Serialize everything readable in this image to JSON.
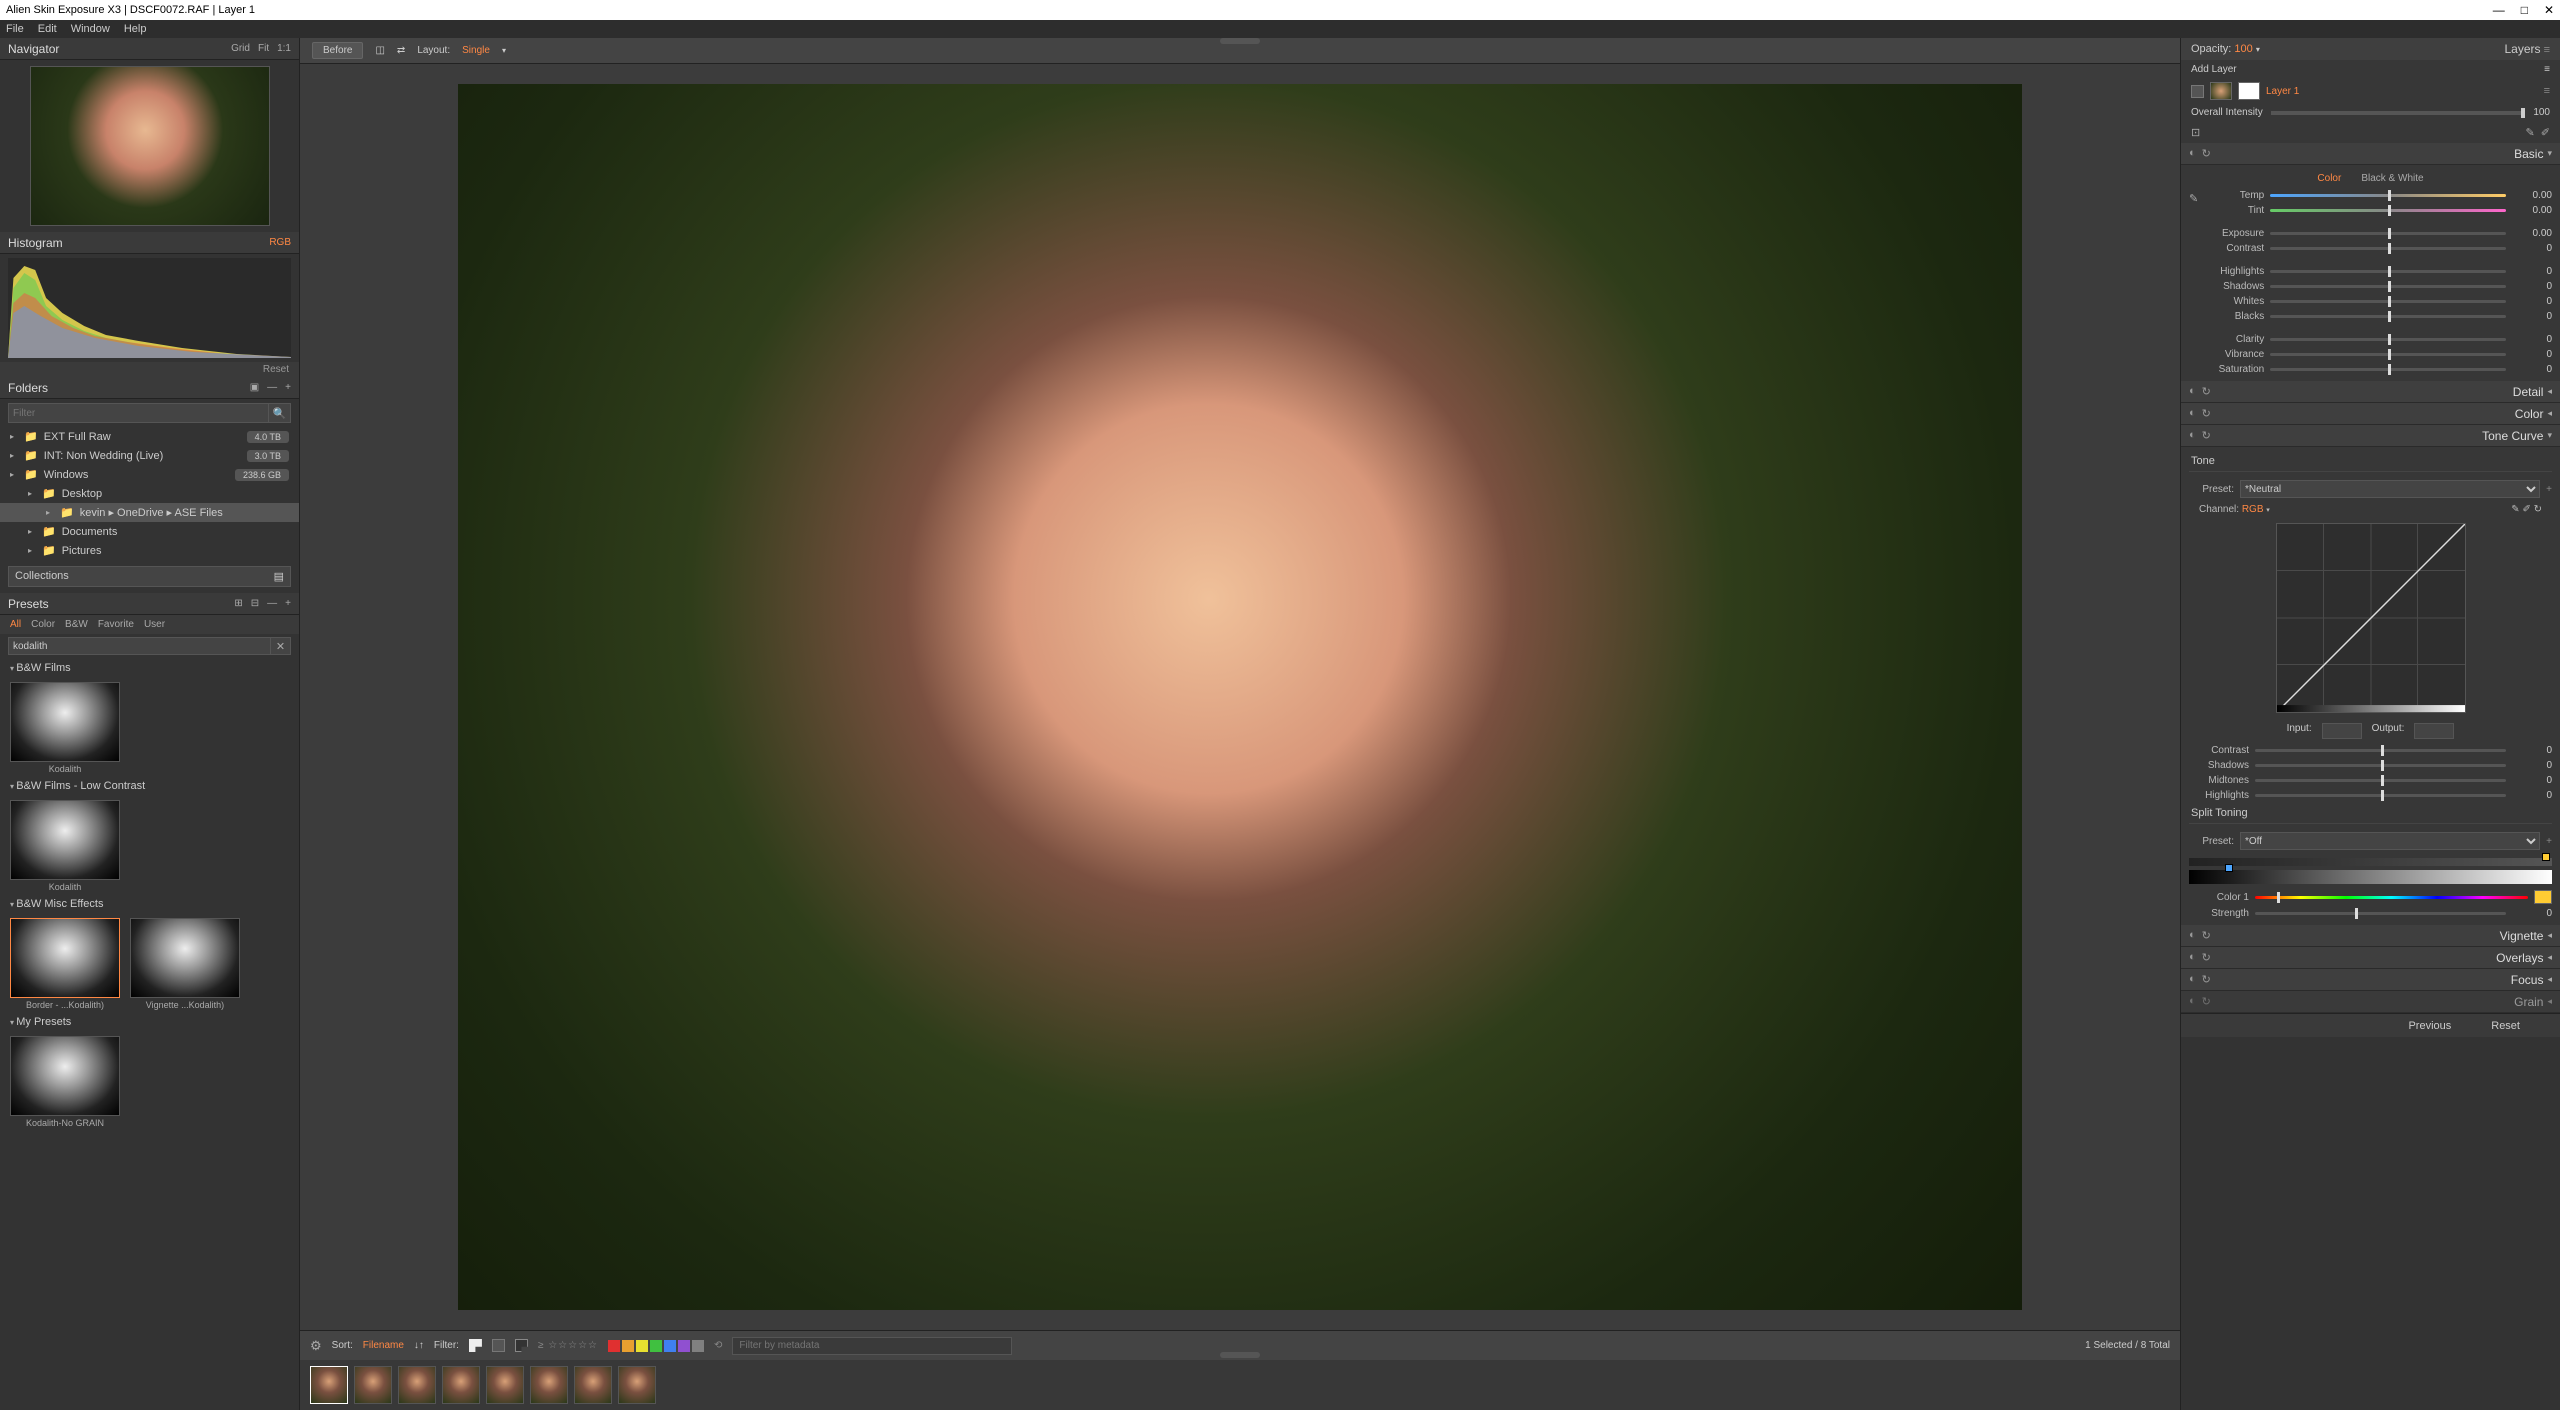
{
  "title": "Alien Skin Exposure X3 | DSCF0072.RAF | Layer 1",
  "menubar": [
    "File",
    "Edit",
    "Window",
    "Help"
  ],
  "navigator": {
    "title": "Navigator",
    "right": [
      "Grid",
      "Fit",
      "1:1"
    ]
  },
  "histogram": {
    "title": "Histogram",
    "mode": "RGB",
    "reset": "Reset"
  },
  "folders": {
    "title": "Folders",
    "filter_ph": "Filter",
    "items": [
      {
        "name": "EXT Full Raw",
        "badge": "4.0 TB"
      },
      {
        "name": "INT: Non Wedding (Live)",
        "badge": "3.0 TB"
      },
      {
        "name": "Windows",
        "badge": "238.6 GB"
      },
      {
        "name": "Desktop",
        "indent": 1
      },
      {
        "name": "kevin ▸ OneDrive ▸ ASE Files",
        "indent": 2,
        "sel": true
      },
      {
        "name": "Documents",
        "indent": 1
      },
      {
        "name": "Pictures",
        "indent": 1
      }
    ],
    "collections": "Collections"
  },
  "presets": {
    "title": "Presets",
    "tabs": [
      "All",
      "Color",
      "B&W",
      "Favorite",
      "User"
    ],
    "search": "kodalith",
    "groups": [
      {
        "name": "B&W Films",
        "items": [
          {
            "label": "Kodalith"
          }
        ]
      },
      {
        "name": "B&W Films - Low Contrast",
        "items": [
          {
            "label": "Kodalith"
          }
        ]
      },
      {
        "name": "B&W Misc Effects",
        "items": [
          {
            "label": "Border - ...Kodalith)"
          },
          {
            "label": "Vignette ...Kodalith)"
          }
        ]
      },
      {
        "name": "My Presets",
        "items": [
          {
            "label": "Kodalith-No GRAIN"
          }
        ]
      }
    ]
  },
  "center": {
    "before": "Before",
    "layout_lbl": "Layout:",
    "layout_val": "Single",
    "sort_lbl": "Sort:",
    "sort_val": "Filename",
    "filter_lbl": "Filter:",
    "filter_ph": "Filter by metadata",
    "count": "1 Selected / 8 Total",
    "thumbs": 8,
    "colors": [
      "#e03030",
      "#e8a030",
      "#e8e030",
      "#40c040",
      "#4080f0",
      "#9050d0",
      "#808080"
    ]
  },
  "right": {
    "opacity_lbl": "Opacity:",
    "opacity_val": "100",
    "layers_title": "Layers",
    "add_layer": "Add Layer",
    "layer_name": "Layer 1",
    "intensity_lbl": "Overall Intensity",
    "intensity_val": "100",
    "basic": {
      "title": "Basic",
      "tabs": [
        "Color",
        "Black & White"
      ],
      "sliders": [
        {
          "lbl": "Temp",
          "val": "0.00",
          "cls": "temp"
        },
        {
          "lbl": "Tint",
          "val": "0.00",
          "cls": "tint"
        },
        {
          "lbl": "Exposure",
          "val": "0.00"
        },
        {
          "lbl": "Contrast",
          "val": "0"
        },
        {
          "lbl": "Highlights",
          "val": "0"
        },
        {
          "lbl": "Shadows",
          "val": "0"
        },
        {
          "lbl": "Whites",
          "val": "0"
        },
        {
          "lbl": "Blacks",
          "val": "0"
        },
        {
          "lbl": "Clarity",
          "val": "0"
        },
        {
          "lbl": "Vibrance",
          "val": "0"
        },
        {
          "lbl": "Saturation",
          "val": "0"
        }
      ]
    },
    "detail": "Detail",
    "color": "Color",
    "tone_curve": {
      "title": "Tone Curve",
      "tone": "Tone",
      "preset_lbl": "Preset:",
      "preset_val": "*Neutral",
      "channel_lbl": "Channel:",
      "channel_val": "RGB",
      "input_lbl": "Input:",
      "output_lbl": "Output:",
      "sliders": [
        {
          "lbl": "Contrast",
          "val": "0"
        },
        {
          "lbl": "Shadows",
          "val": "0"
        },
        {
          "lbl": "Midtones",
          "val": "0"
        },
        {
          "lbl": "Highlights",
          "val": "0"
        }
      ]
    },
    "split": {
      "title": "Split Toning",
      "preset_lbl": "Preset:",
      "preset_val": "*Off",
      "color1_lbl": "Color 1",
      "strength_lbl": "Strength",
      "strength_val": "0"
    },
    "vignette": "Vignette",
    "overlays": "Overlays",
    "focus": "Focus",
    "grain": "Grain"
  },
  "bottom": {
    "previous": "Previous",
    "reset": "Reset"
  }
}
